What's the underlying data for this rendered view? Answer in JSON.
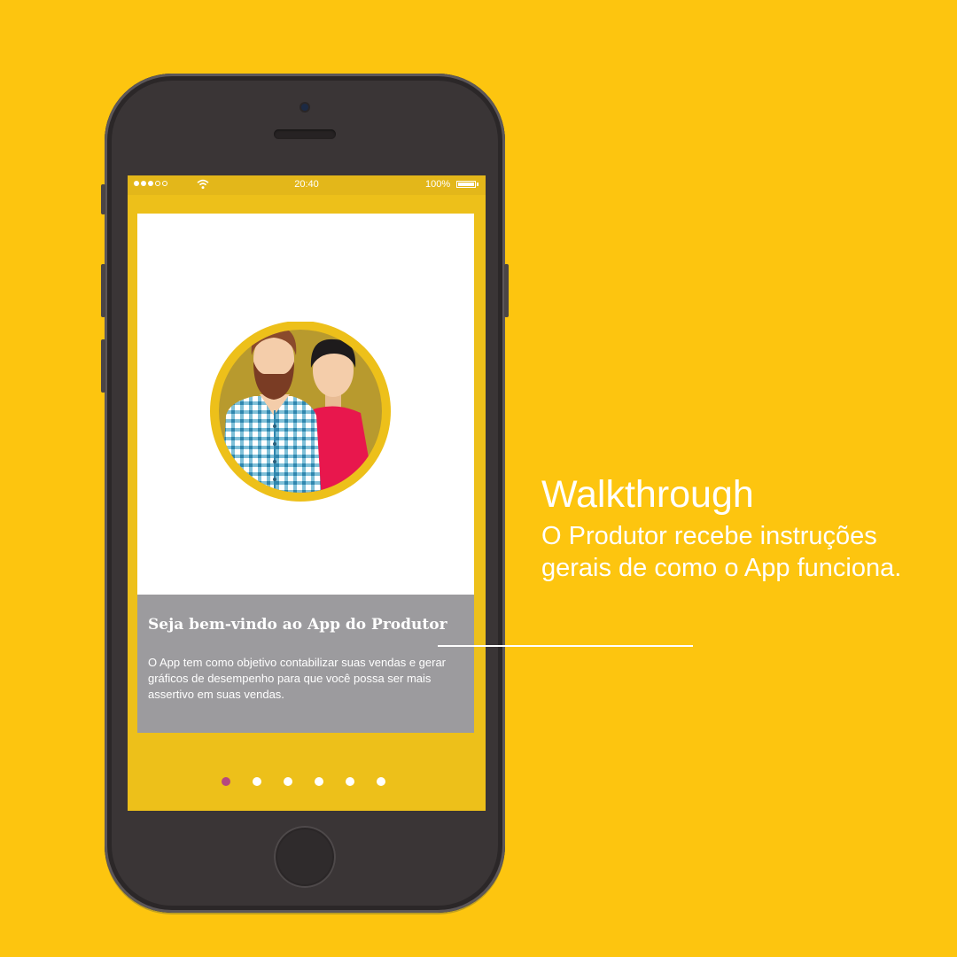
{
  "status_bar": {
    "time": "20:40",
    "battery": "100%",
    "signal_bars_filled": 3,
    "signal_bars_total": 5
  },
  "card": {
    "title": "Seja bem-vindo ao App do Produtor",
    "body": "O App tem como objetivo contabilizar suas vendas e gerar gráficos de desempenho para que você possa ser mais assertivo em suas vendas."
  },
  "pagination": {
    "total": 6,
    "active_index": 0
  },
  "heading": "Walkthrough",
  "description": "O Produtor recebe instruções gerais de como o App funciona.",
  "colors": {
    "background": "#FDC50F",
    "screen": "#EDC01A",
    "card_info": "#9C9B9E",
    "active_dot": "#B5487F"
  },
  "icons": {
    "wifi": "wifi-icon",
    "battery": "battery-icon",
    "avatar": "producers-avatar-icon"
  }
}
